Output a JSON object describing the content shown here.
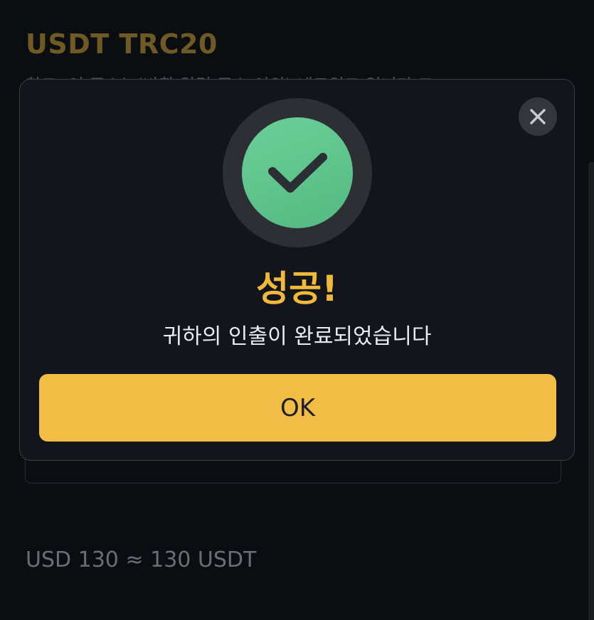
{
  "background": {
    "title": "USDT TRC20",
    "subtitle": "참고: 이 주소는(반환 알림 주소 이외) 네트워크 입니다 그",
    "conversion": "USD 130 ≈ 130 USDT"
  },
  "dialog": {
    "close_icon": "close-icon",
    "status_icon": "check-circle-icon",
    "title": "성공!",
    "message": "귀하의 인출이 완료되었습니다",
    "ok_label": "OK"
  },
  "colors": {
    "accent": "#f2bd45",
    "title": "#f0b93a",
    "success": "#5ec48a",
    "background": "#0b0e11",
    "dialog": "#12151b"
  }
}
